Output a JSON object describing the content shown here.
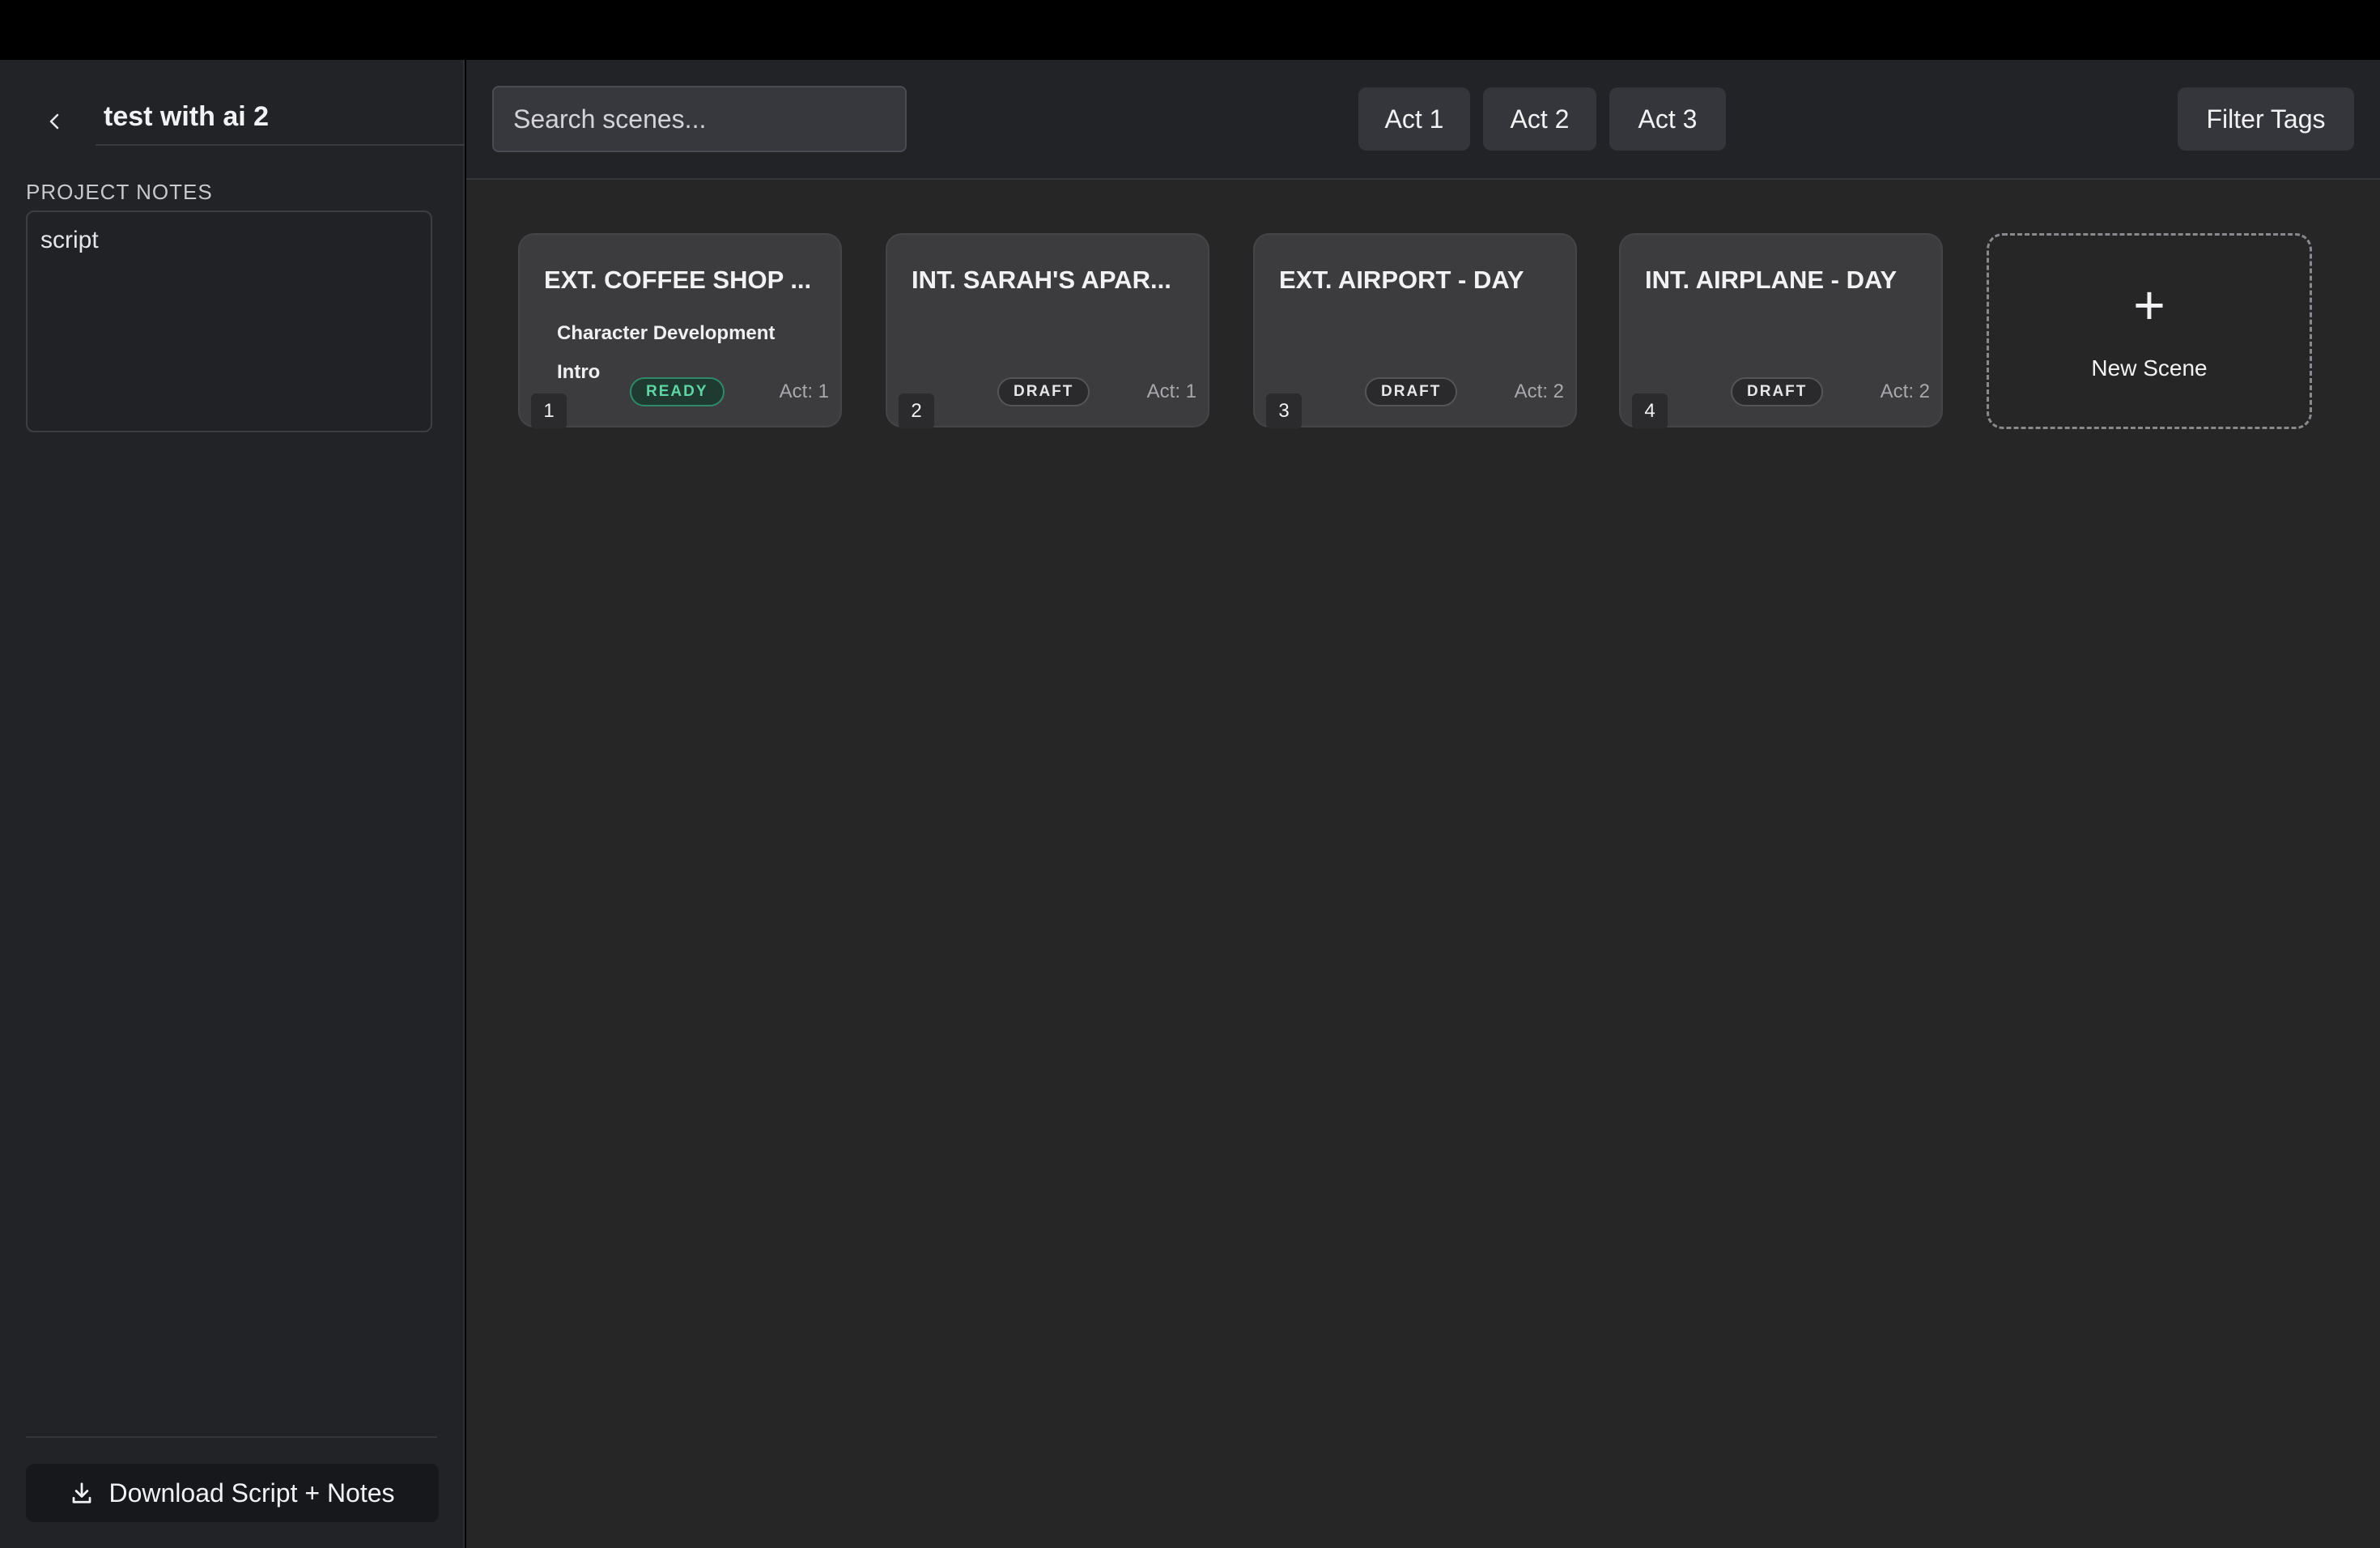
{
  "project": {
    "title": "test with ai 2",
    "notes_label": "PROJECT NOTES",
    "notes": "script",
    "download_label": "Download Script + Notes"
  },
  "toolbar": {
    "search_placeholder": "Search scenes...",
    "acts": [
      "Act 1",
      "Act 2",
      "Act 3"
    ],
    "filter_label": "Filter Tags"
  },
  "scenes": [
    {
      "number": "1",
      "title": "EXT. COFFEE SHOP ...",
      "tags": [
        "Character Development",
        "Intro"
      ],
      "status": "READY",
      "act": "Act: 1"
    },
    {
      "number": "2",
      "title": "INT. SARAH'S APAR...",
      "tags": [],
      "status": "DRAFT",
      "act": "Act: 1"
    },
    {
      "number": "3",
      "title": "EXT. AIRPORT - DAY",
      "tags": [],
      "status": "DRAFT",
      "act": "Act: 2"
    },
    {
      "number": "4",
      "title": "INT. AIRPLANE - DAY",
      "tags": [],
      "status": "DRAFT",
      "act": "Act: 2"
    }
  ],
  "new_scene": {
    "plus": "+",
    "label": "New Scene"
  },
  "colors": {
    "ready_border": "#2f8a67",
    "ready_text": "#5fd6a5",
    "card_bg": "#3c3c3e",
    "sidebar_bg": "#222326"
  }
}
